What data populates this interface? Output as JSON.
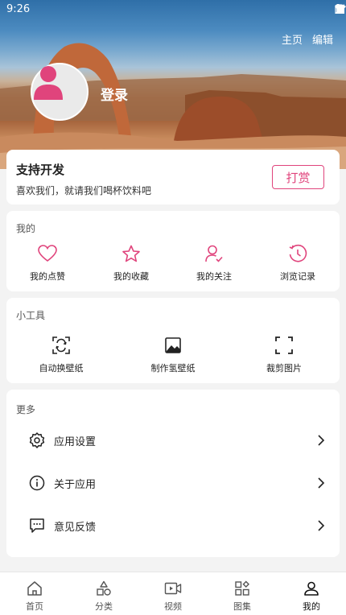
{
  "status_bar": {
    "time": "9:26"
  },
  "header": {
    "home_link": "主页",
    "edit_link": "编辑",
    "login_label": "登录"
  },
  "support": {
    "title": "支持开发",
    "description": "喜欢我们，就请我们喝杯饮料吧",
    "reward_label": "打赏"
  },
  "mine": {
    "title": "我的",
    "items": [
      {
        "label": "我的点赞",
        "icon": "heart-icon"
      },
      {
        "label": "我的收藏",
        "icon": "star-icon"
      },
      {
        "label": "我的关注",
        "icon": "user-check-icon"
      },
      {
        "label": "浏览记录",
        "icon": "history-icon"
      }
    ]
  },
  "tools": {
    "title": "小工具",
    "items": [
      {
        "label": "自动换壁纸",
        "icon": "auto-wallpaper-icon"
      },
      {
        "label": "制作氢壁纸",
        "icon": "image-icon"
      },
      {
        "label": "裁剪图片",
        "icon": "crop-icon"
      }
    ]
  },
  "more": {
    "title": "更多",
    "items": [
      {
        "label": "应用设置",
        "icon": "gear-icon"
      },
      {
        "label": "关于应用",
        "icon": "info-icon"
      },
      {
        "label": "意见反馈",
        "icon": "feedback-icon"
      }
    ]
  },
  "bottom_nav": {
    "items": [
      {
        "label": "首页",
        "icon": "home-icon"
      },
      {
        "label": "分类",
        "icon": "category-icon"
      },
      {
        "label": "视频",
        "icon": "video-icon"
      },
      {
        "label": "图集",
        "icon": "gallery-icon"
      },
      {
        "label": "我的",
        "icon": "profile-icon"
      }
    ],
    "active": "我的"
  },
  "colors": {
    "accent": "#e0447c",
    "background": "#f3f3f3"
  }
}
